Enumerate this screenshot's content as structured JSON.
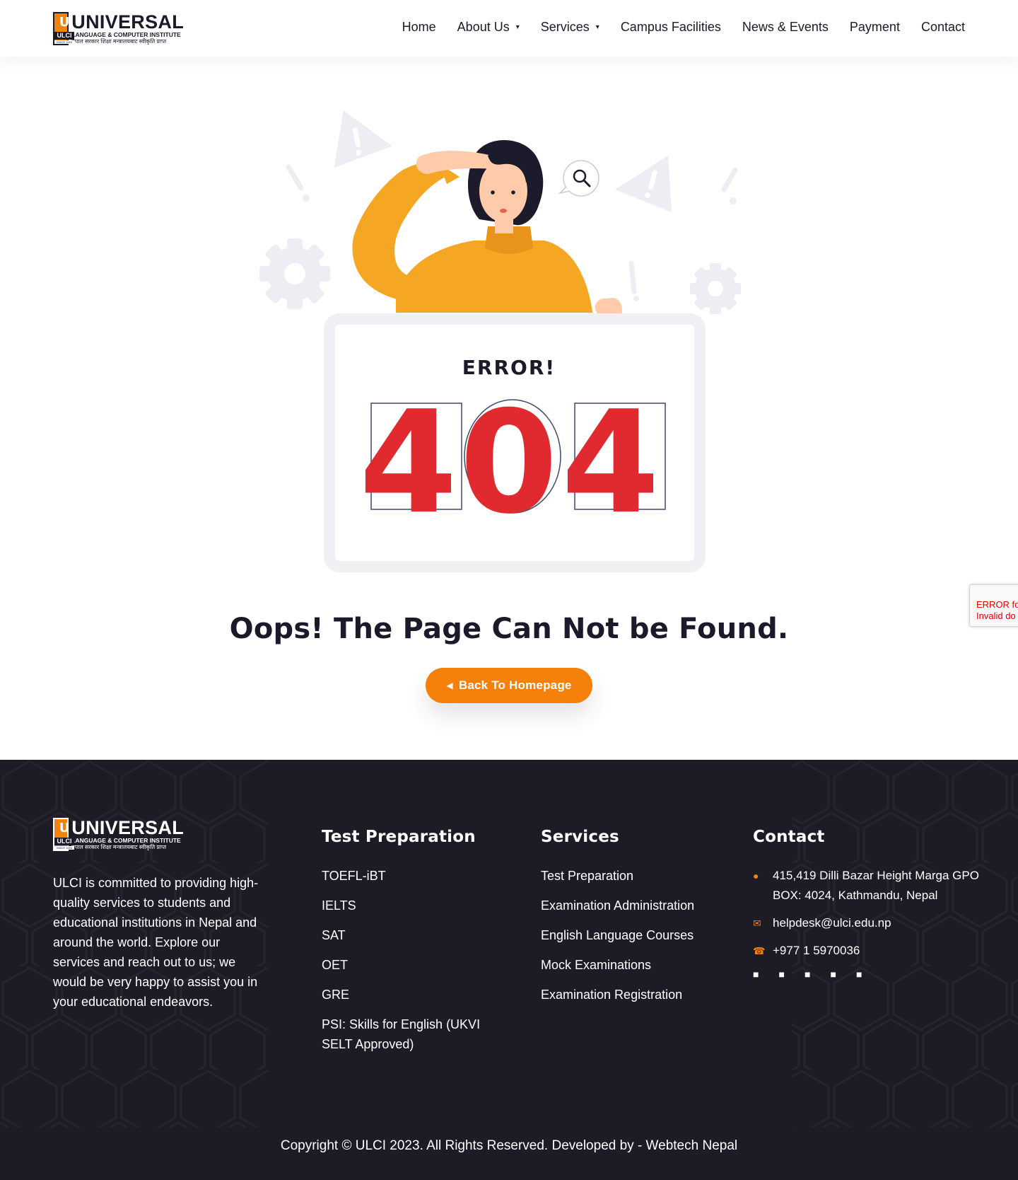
{
  "brand": {
    "name": "UNIVERSAL",
    "sub": "LANGUAGE & COMPUTER INSTITUTE",
    "nepali": "नेपाल सरकार शिक्षा मन्त्रालयबाट स्वीकृति प्राप्त",
    "badge_letter": "U",
    "badge_text": "ULCI",
    "since": "SINCE 1994"
  },
  "nav": {
    "items": [
      {
        "label": "Home"
      },
      {
        "label": "About Us",
        "dropdown": true
      },
      {
        "label": "Services",
        "dropdown": true
      },
      {
        "label": "Campus Facilities"
      },
      {
        "label": "News & Events"
      },
      {
        "label": "Payment"
      },
      {
        "label": "Contact"
      }
    ],
    "caret_icon": "chevron-down-icon"
  },
  "error": {
    "label": "ERROR!",
    "code_digits": [
      "4",
      "0",
      "4"
    ],
    "headline": "Oops! The Page Can Not be Found.",
    "button_label": "Back To Homepage",
    "button_icon": "arrow-left-icon"
  },
  "footer": {
    "about": "ULCI is committed to providing high-quality services to students and educational institutions in Nepal and around the world. Explore our services and reach out to us; we would be very happy to assist you in your educational endeavors.",
    "test_prep": {
      "title": "Test Preparation",
      "items": [
        "TOEFL-iBT",
        "IELTS",
        "SAT",
        "OET",
        "GRE",
        "PSI: Skills for English (UKVI SELT Approved)"
      ]
    },
    "services": {
      "title": "Services",
      "items": [
        "Test Preparation",
        "Examination Administration",
        "English Language Courses",
        "Mock Examinations",
        "Examination Registration"
      ]
    },
    "contact": {
      "title": "Contact",
      "address": "415,419 Dilli Bazar Height Marga GPO BOX: 4024, Kathmandu, Nepal",
      "email": "helpdesk@ulci.edu.np",
      "phone": "+977 1 5970036",
      "socials": [
        "facebook-icon",
        "twitter-icon",
        "instagram-icon",
        "linkedin-icon",
        "youtube-icon"
      ]
    },
    "copyright": "Copyright © ULCI 2023. All Rights Reserved. Developed by - Webtech Nepal"
  },
  "recaptcha": {
    "line1": "ERROR fo",
    "line2": "Invalid do"
  },
  "colors": {
    "accent": "#f5800a",
    "dark": "#1d1b26",
    "error_red": "#e02a2f",
    "sweater": "#f5a623"
  }
}
